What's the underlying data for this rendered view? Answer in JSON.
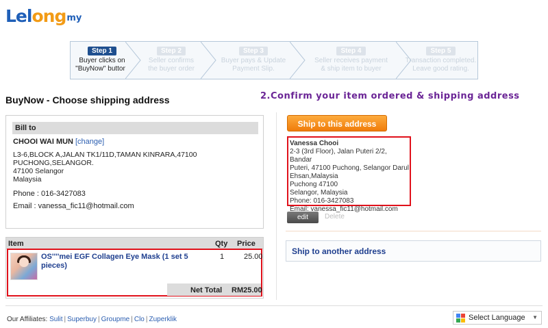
{
  "brand": {
    "part1": "Lel",
    "part2": "ong",
    "part3": "my"
  },
  "steps": [
    {
      "badge": "Step 1",
      "line1": "Buyer clicks on",
      "line2": "\"BuyNow\" button."
    },
    {
      "badge": "Step 2",
      "line1": "Seller confirms",
      "line2": "the buyer order"
    },
    {
      "badge": "Step 3",
      "line1": "Buyer pays & Update",
      "line2": "Payment Slip."
    },
    {
      "badge": "Step 4",
      "line1": "Seller receives payment",
      "line2": "& ship item to buyer"
    },
    {
      "badge": "Step 5",
      "line1": "Transaction completed.",
      "line2": "Leave good rating."
    }
  ],
  "page_title": "BuyNow - Choose shipping address",
  "confirm_title": "2.Confirm your item ordered & shipping address",
  "billto": {
    "header": "Bill to",
    "name": "CHOOI WAI MUN",
    "change": "[change]",
    "addr1": "L3-6,BLOCK A,JALAN TK1/11D,TAMAN KINRARA,47100",
    "addr2": "PUCHONG,SELANGOR.",
    "addr3": "47100 Selangor",
    "addr4": "Malaysia",
    "phone": "Phone : 016-3427083",
    "email": "Email : vanessa_fic11@hotmail.com"
  },
  "items": {
    "headers": {
      "item": "Item",
      "qty": "Qty",
      "price": "Price"
    },
    "row": {
      "name": "OS''''mei EGF Collagen Eye Mask (1 set 5 pieces)",
      "qty": "1",
      "price": "25.00"
    },
    "net_label": "Net Total",
    "net_value": "RM25.00"
  },
  "ship": {
    "button": "Ship to this address",
    "name": "Vanessa Chooi",
    "lines": [
      "2-3 (3rd Floor), Jalan Puteri 2/2, Bandar",
      "Puteri, 47100 Puchong, Selangor Darul",
      "Ehsan,Malaysia",
      "Puchong 47100",
      "Selangor, Malaysia",
      "Phone: 016-3427083",
      "Email: vanessa_fic11@hotmail.com"
    ],
    "edit": "edit",
    "delete": "Delete",
    "another": "Ship to another address"
  },
  "footer": {
    "label": "Our Affiliates:",
    "links": [
      "Sulit",
      "Superbuy",
      "Groupme",
      "Clo",
      "Zuperklik"
    ],
    "language": "Select Language"
  },
  "colors": {
    "accent_blue": "#1f5fb8",
    "orange": "#f07c0a",
    "highlight_red": "#e0101a",
    "title_purple": "#6b2596"
  }
}
